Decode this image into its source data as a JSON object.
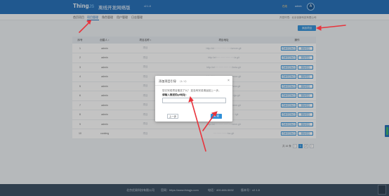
{
  "header": {
    "logo_main": "Thing",
    "logo_accent": "JS",
    "app_title": "离线开发网络版",
    "version": "v2.1.8",
    "user_status": "在线",
    "user_name": "admin",
    "avatar_letter": "A"
  },
  "nav": {
    "items": [
      "首页项目",
      "项目管理",
      "角色管理",
      "用户管理",
      "日志管理"
    ],
    "active_index": 1,
    "right_text": "开发环境：北京创新科技有限公司"
  },
  "toolbar": {
    "add_label": "添加项目"
  },
  "table": {
    "headers": [
      "序号",
      "创建人 ↕",
      "项目名称 ↕",
      "项目地址",
      "操作"
    ],
    "rows": [
      {
        "index": "1",
        "creator": "admin",
        "name": "项目",
        "url": "http://el····················/server.git",
        "blurred": true
      },
      {
        "index": "2",
        "creator": "admin",
        "name": "项目",
        "url": "http://el······················/a.git",
        "blurred": true
      },
      {
        "index": "3",
        "creator": "admin",
        "name": "项目",
        "url": "http://el·····················/beta.git",
        "blurred": true
      },
      {
        "index": "4",
        "creator": "admin",
        "name": "项目",
        "url": "http://el····················/vision.git",
        "blurred": true
      },
      {
        "index": "5",
        "creator": "admin",
        "name": "项目",
        "url": "http://el·····················/one.git",
        "blurred": true
      },
      {
        "index": "6",
        "creator": "admin",
        "name": "项目",
        "url": "http://el······················/gs.git",
        "blurred": true
      },
      {
        "index": "7",
        "creator": "admin",
        "name": "项目",
        "url": "http://el·····················/ome.git",
        "blurred": true
      },
      {
        "index": "8",
        "creator": "admin",
        "name": "项目",
        "url": "http://el······················/git",
        "blurred": true
      },
      {
        "index": "9",
        "creator": "admin",
        "name": "项目",
        "url": "http://el·····················/ome.git",
        "blurred": true
      },
      {
        "index": "10",
        "creator": "cooking",
        "name": "项目",
        "url": "·················/oo.git",
        "blurred": true
      }
    ],
    "row_actions": [
      "查看项目信息",
      "删除项目"
    ]
  },
  "pager": {
    "total": "共 16 条",
    "pages": [
      "1",
      "2"
    ],
    "current": "1",
    "prev": "‹",
    "next": "›"
  },
  "modal": {
    "title": "添加项目引导",
    "step": "（4 / 4）",
    "close": "×",
    "question": "您已完成项目推送了么？ 如没有完成请返回上一步。",
    "prompt": "请输入推送的git地址：",
    "input_value": "",
    "input_placeholder": "",
    "prev_label": "上一步",
    "ok_label": "确 定"
  },
  "footer": {
    "company": "北京优易科技有限公司",
    "website": "官网：https://www.thingjs.com",
    "phone": "电话：400-666-5832",
    "version_label": "版本号：v2.1.8"
  },
  "colors": {
    "header_bg": "#1e6bb8",
    "primary": "#2f8fd8",
    "footer_bg": "#34495e",
    "annotation_arrow": "#e8343c"
  }
}
